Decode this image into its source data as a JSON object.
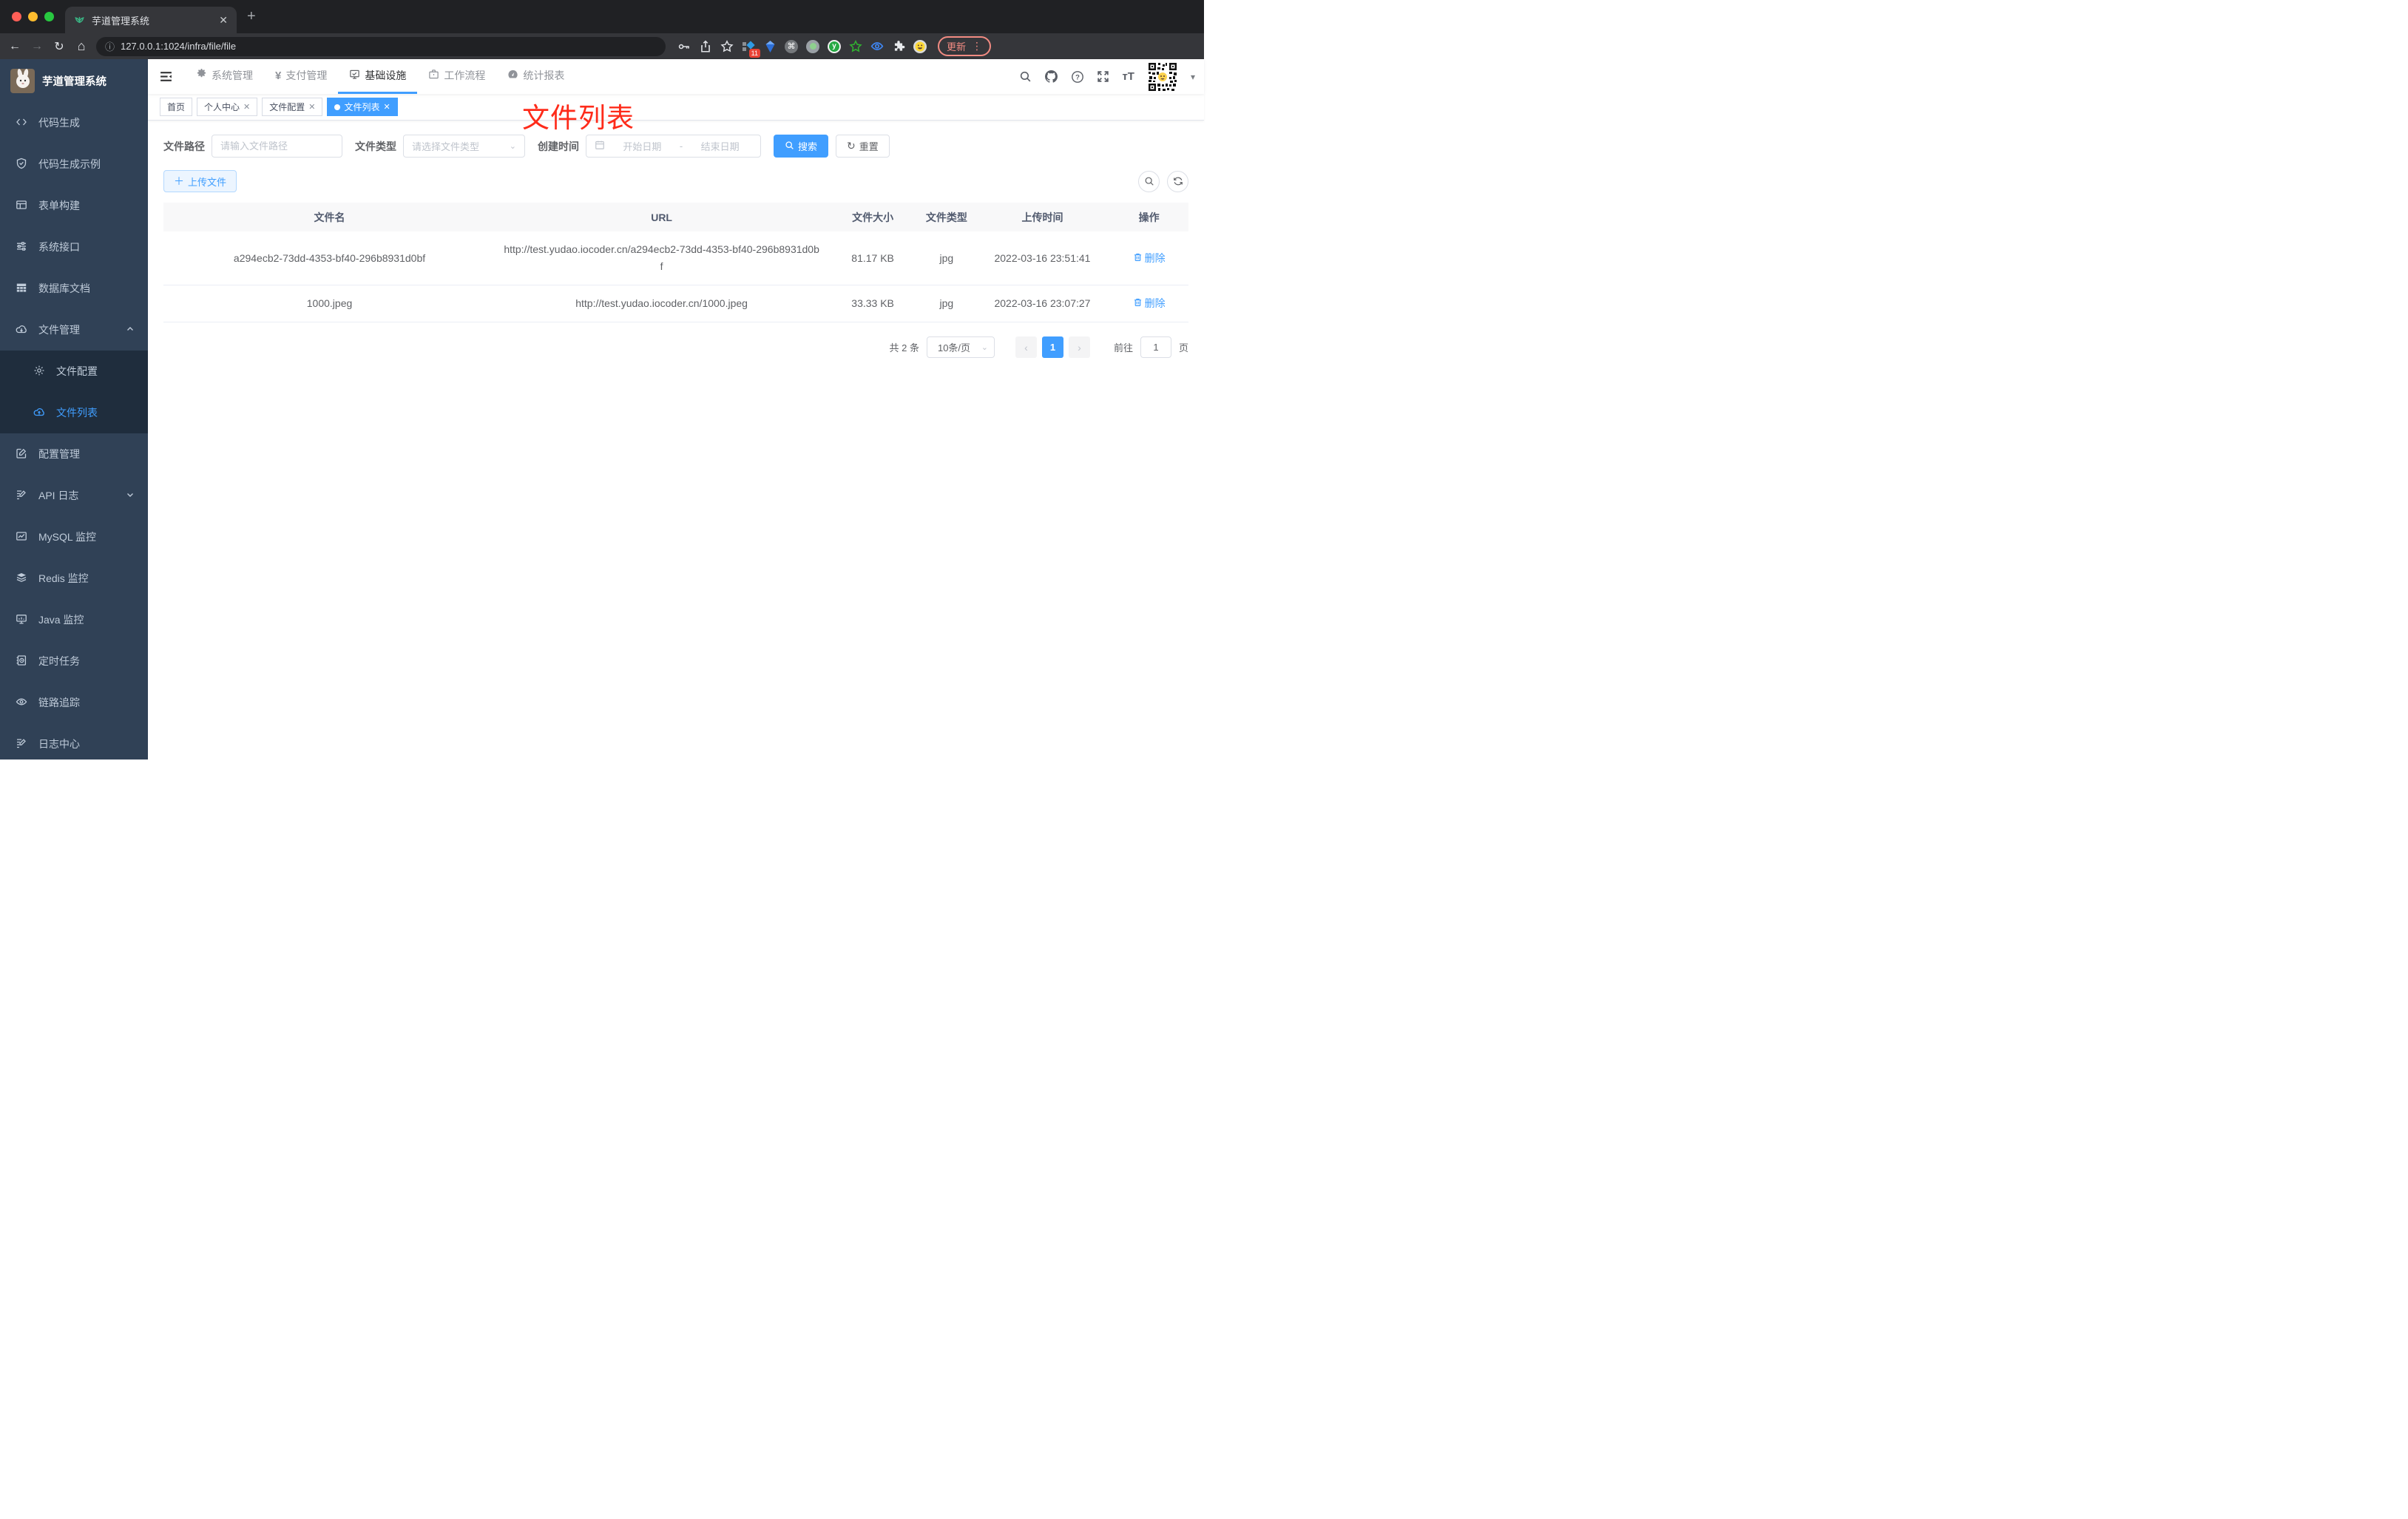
{
  "browser": {
    "tab_title": "芋道管理系统",
    "new_tab": "+",
    "url": "127.0.0.1:1024/infra/file/file",
    "extension_badge": "11",
    "update_button": "更新"
  },
  "sidebar": {
    "logo_title": "芋道管理系统",
    "items": [
      {
        "label": "代码生成"
      },
      {
        "label": "代码生成示例"
      },
      {
        "label": "表单构建"
      },
      {
        "label": "系统接口"
      },
      {
        "label": "数据库文档"
      },
      {
        "label": "文件管理"
      },
      {
        "label": "文件配置"
      },
      {
        "label": "文件列表"
      },
      {
        "label": "配置管理"
      },
      {
        "label": "API 日志"
      },
      {
        "label": "MySQL 监控"
      },
      {
        "label": "Redis 监控"
      },
      {
        "label": "Java 监控"
      },
      {
        "label": "定时任务"
      },
      {
        "label": "链路追踪"
      },
      {
        "label": "日志中心"
      }
    ]
  },
  "header": {
    "menus": [
      {
        "label": "系统管理"
      },
      {
        "label": "支付管理"
      },
      {
        "label": "基础设施"
      },
      {
        "label": "工作流程"
      },
      {
        "label": "统计报表"
      }
    ]
  },
  "tags": [
    {
      "label": "首页"
    },
    {
      "label": "个人中心"
    },
    {
      "label": "文件配置"
    },
    {
      "label": "文件列表"
    }
  ],
  "annotation": "文件列表",
  "filters": {
    "path_label": "文件路径",
    "path_placeholder": "请输入文件路径",
    "type_label": "文件类型",
    "type_placeholder": "请选择文件类型",
    "time_label": "创建时间",
    "start_placeholder": "开始日期",
    "range_separator": "-",
    "end_placeholder": "结束日期",
    "search_label": "搜索",
    "reset_label": "重置"
  },
  "toolbar": {
    "upload_label": "上传文件"
  },
  "table": {
    "columns": [
      "文件名",
      "URL",
      "文件大小",
      "文件类型",
      "上传时间",
      "操作"
    ],
    "rows": [
      {
        "name": "a294ecb2-73dd-4353-bf40-296b8931d0bf",
        "url": "http://test.yudao.iocoder.cn/a294ecb2-73dd-4353-bf40-296b8931d0bf",
        "size": "81.17 KB",
        "type": "jpg",
        "time": "2022-03-16 23:51:41",
        "action": "删除"
      },
      {
        "name": "1000.jpeg",
        "url": "http://test.yudao.iocoder.cn/1000.jpeg",
        "size": "33.33 KB",
        "type": "jpg",
        "time": "2022-03-16 23:07:27",
        "action": "删除"
      }
    ]
  },
  "pagination": {
    "total": "共 2 条",
    "page_size": "10条/页",
    "current": "1",
    "goto_label": "前往",
    "goto_value": "1",
    "goto_unit": "页"
  },
  "colors": {
    "primary": "#409eff",
    "sidebar_bg": "#304156",
    "submenu_bg": "#1f2d3d",
    "annotation": "#fe2b1a"
  }
}
